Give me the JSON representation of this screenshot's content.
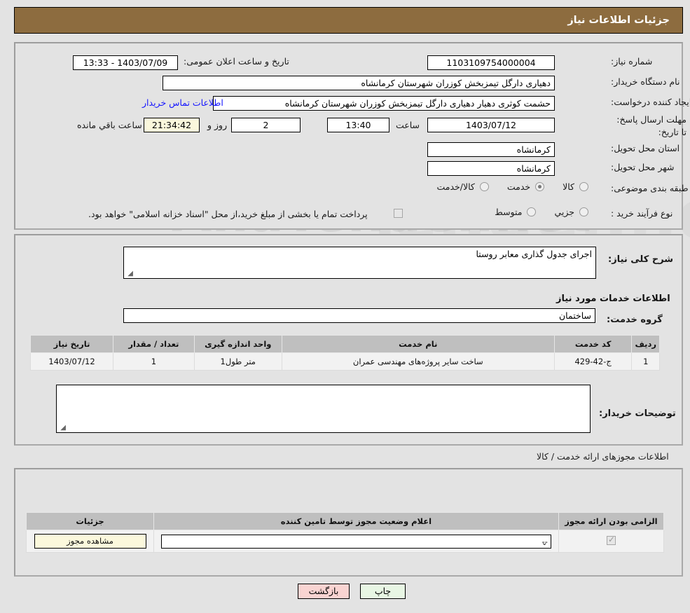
{
  "header": {
    "title": "جزئیات اطلاعات نیاز"
  },
  "need_info": {
    "need_number_label": "شماره نیاز:",
    "need_number_value": "1103109754000004",
    "announce_label": "تاریخ و ساعت اعلان عمومی:",
    "announce_value": "1403/07/09 - 13:33",
    "buyer_org_label": "نام دستگاه خریدار:",
    "buyer_org_value": "دهیاری دارگل تیمزبخش کوزران شهرستان کرمانشاه",
    "creator_label": "ایجاد کننده درخواست:",
    "creator_value": "حشمت کوثری دهیار دهیاری دارگل تیمزبخش کوزران شهرستان کرمانشاه",
    "contact_link": "اطلاعات تماس خریدار",
    "deadline_label": "مهلت ارسال پاسخ: تا تاریخ:",
    "deadline_date": "1403/07/12",
    "deadline_time_label": "ساعت",
    "deadline_time": "13:40",
    "remaining_days": "2",
    "remaining_days_label": "روز و",
    "remaining_clock": "21:34:42",
    "remaining_suffix": "ساعت باقي مانده",
    "province_label": "استان محل تحویل:",
    "province_value": "کرمانشاه",
    "city_label": "شهر محل تحویل:",
    "city_value": "کرمانشاه",
    "category_label": "طبقه بندی موضوعی:",
    "category_options": [
      {
        "label": "کالا",
        "selected": false
      },
      {
        "label": "خدمت",
        "selected": true
      },
      {
        "label": "کالا/خدمت",
        "selected": false
      }
    ],
    "process_label": "نوع فرآیند خرید :",
    "process_options": [
      {
        "label": "جزیي",
        "selected": false
      },
      {
        "label": "متوسط",
        "selected": false
      }
    ],
    "treasury_checkbox_checked": false,
    "treasury_text": "پرداخت تمام یا بخشی از مبلغ خرید،از محل \"اسناد خزانه اسلامی\" خواهد بود."
  },
  "description": {
    "general_label": "شرح کلی نیاز:",
    "general_value": "اجرای جدول گذاری معابر روستا",
    "services_heading": "اطلاعات خدمات مورد نیاز",
    "service_group_label": "گروه خدمت:",
    "service_group_value": "ساختمان",
    "buyer_notes_label": "توضیحات خریدار:",
    "buyer_notes_value": ""
  },
  "services_table": {
    "columns": [
      "ردیف",
      "کد خدمت",
      "نام خدمت",
      "واحد اندازه گیری",
      "تعداد / مقدار",
      "تاریخ نیاز"
    ],
    "rows": [
      {
        "row": "1",
        "code": "ج-42-429",
        "name": "ساخت سایر پروژه‌های مهندسی عمران",
        "unit": "متر طول1",
        "qty": "1",
        "date": "1403/07/12"
      }
    ]
  },
  "permits": {
    "heading": "اطلاعات مجوزهای ارائه خدمت / کالا",
    "columns": [
      "الزامی بودن ارائه مجوز",
      "اعلام وضعیت مجوز توسط تامین کننده",
      "جزئیات"
    ],
    "rows": [
      {
        "required_checked": true,
        "status_value": "--",
        "details_button": "مشاهده مجوز"
      }
    ]
  },
  "footer": {
    "print_label": "چاپ",
    "back_label": "بازگشت"
  },
  "colors": {
    "header_bar": "#8d6c3f",
    "page_bg": "#e3e3e3",
    "link": "#1414ff",
    "back_button": "#f9d4d2",
    "print_button": "#e8f6e4",
    "highlight_field": "#fbf8dc"
  },
  "watermark": {
    "text": "AnaTender.net"
  }
}
